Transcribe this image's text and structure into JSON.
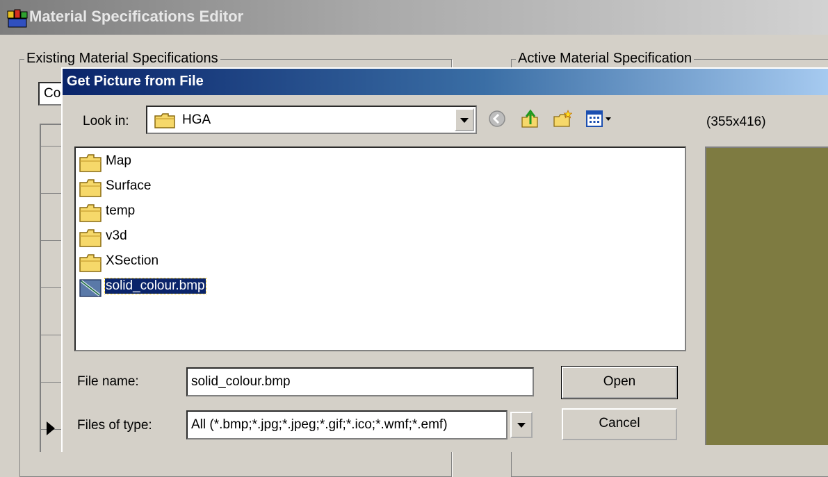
{
  "parent_window": {
    "title": "Material Specifications Editor",
    "group_existing_label": "Existing Material Specifications",
    "group_active_label": "Active Material Specification",
    "combo_value": "Co"
  },
  "dialog": {
    "title": "Get Picture from File",
    "look_in_label": "Look in:",
    "look_in_value": "HGA",
    "toolbar_icons": [
      "back-icon",
      "up-folder-icon",
      "new-folder-icon",
      "view-menu-icon"
    ],
    "preview_dimensions": "(355x416)",
    "preview_color": "#7e7b41",
    "files": [
      {
        "name": "Map",
        "type": "folder",
        "selected": false
      },
      {
        "name": "Surface",
        "type": "folder",
        "selected": false
      },
      {
        "name": "temp",
        "type": "folder",
        "selected": false
      },
      {
        "name": "v3d",
        "type": "folder",
        "selected": false
      },
      {
        "name": "XSection",
        "type": "folder",
        "selected": false
      },
      {
        "name": "solid_colour.bmp",
        "type": "bitmap",
        "selected": true
      }
    ],
    "file_name_label": "File name:",
    "file_name_value": "solid_colour.bmp",
    "files_of_type_label": "Files of type:",
    "files_of_type_value": "All (*.bmp;*.jpg;*.jpeg;*.gif;*.ico;*.wmf;*.emf)",
    "open_label": "Open",
    "cancel_label": "Cancel"
  },
  "colors": {
    "selection": "#0a246a",
    "dialog_title_start": "#0a246a",
    "dialog_title_end": "#a6caf0",
    "face": "#d4d0c8"
  }
}
